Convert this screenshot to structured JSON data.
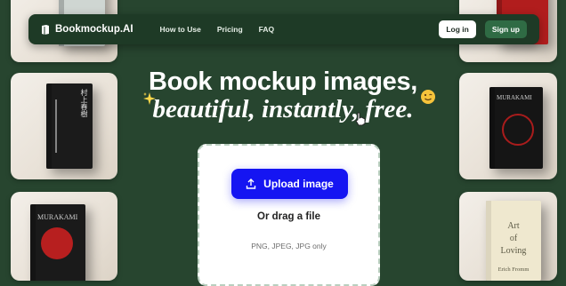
{
  "nav": {
    "brand": "Bookmockup.AI",
    "links": [
      "How to Use",
      "Pricing",
      "FAQ"
    ],
    "login_label": "Log in",
    "signup_label": "Sign up"
  },
  "hero": {
    "line1": "Book mockup images,",
    "line2": "beautiful, instantly, free."
  },
  "upload": {
    "button_label": "Upload image",
    "drag_text": "Or drag a file",
    "formats_text": "PNG, JPEG, JPG only"
  },
  "background_books": {
    "left_middle_author": "村上春樹",
    "left_bottom_author": "MURAKAMI",
    "right_middle_author": "MURAKAMI",
    "right_bottom_title_line1": "Art",
    "right_bottom_title_line2": "of",
    "right_bottom_title_line3": "Loving",
    "right_bottom_author": "Erich Fromm"
  },
  "colors": {
    "background": "#27452f",
    "navbar": "#1e3a26",
    "signup": "#2f6b44",
    "upload_button": "#1515f2"
  },
  "icons": [
    "book-logo-icon",
    "upload-icon",
    "sparkle-icon",
    "smiley-icon",
    "pointer-hand-icon"
  ]
}
